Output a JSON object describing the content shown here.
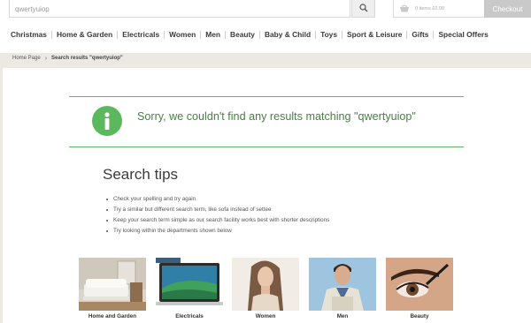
{
  "search": {
    "value": "qwertyuiop"
  },
  "basket": {
    "summary": "0 items  £0.00",
    "checkout_label": "Checkout"
  },
  "nav": {
    "items": [
      {
        "label": "Christmas"
      },
      {
        "label": "Home & Garden"
      },
      {
        "label": "Electricals"
      },
      {
        "label": "Women"
      },
      {
        "label": "Men"
      },
      {
        "label": "Beauty"
      },
      {
        "label": "Baby & Child"
      },
      {
        "label": "Toys"
      },
      {
        "label": "Sport & Leisure"
      },
      {
        "label": "Gifts"
      },
      {
        "label": "Special Offers"
      }
    ]
  },
  "breadcrumb": {
    "home": "Home Page",
    "current": "Search results \"qwertyuiop\""
  },
  "message": {
    "text": "Sorry, we couldn't find any results matching \"qwertyuiop\""
  },
  "tips": {
    "title": "Search tips",
    "items": [
      "Check your spelling and try again",
      "Try a similar but different search term, like sofa instead of settee",
      "Keep your search term simple as our search facility works best with shorter descriptions",
      "Try looking within the departments shown below"
    ]
  },
  "departments": [
    {
      "label": "Home and Garden"
    },
    {
      "label": "Electricals"
    },
    {
      "label": "Women"
    },
    {
      "label": "Men"
    },
    {
      "label": "Beauty"
    }
  ],
  "colors": {
    "accent": "#5cb85c",
    "message_text": "#4a7f45",
    "page_bg": "#ece9e3"
  }
}
